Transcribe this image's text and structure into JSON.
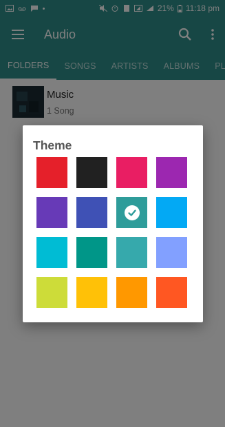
{
  "status": {
    "battery": "21%",
    "time": "11:18 pm"
  },
  "app_bar": {
    "title": "Audio"
  },
  "tabs": [
    {
      "label": "FOLDERS",
      "active": true
    },
    {
      "label": "SONGS"
    },
    {
      "label": "ARTISTS"
    },
    {
      "label": "ALBUMS"
    },
    {
      "label": "PLAYLISTS"
    }
  ],
  "list": [
    {
      "title": "Music",
      "subtitle": "1 Song"
    }
  ],
  "dialog": {
    "title": "Theme",
    "selected_index": 6,
    "swatches": [
      {
        "name": "red",
        "color": "#e5202a"
      },
      {
        "name": "black",
        "color": "#212121"
      },
      {
        "name": "pink",
        "color": "#e91e63"
      },
      {
        "name": "purple",
        "color": "#9c27b0"
      },
      {
        "name": "deep-purple",
        "color": "#673ab7"
      },
      {
        "name": "indigo",
        "color": "#3f51b5"
      },
      {
        "name": "teal-selected",
        "color": "#2e9c9a"
      },
      {
        "name": "light-blue",
        "color": "#03a9f4"
      },
      {
        "name": "cyan",
        "color": "#00bcd4"
      },
      {
        "name": "teal",
        "color": "#009688"
      },
      {
        "name": "light-teal",
        "color": "#36a9ac"
      },
      {
        "name": "periwinkle",
        "color": "#82a0ff"
      },
      {
        "name": "lime",
        "color": "#cddc39"
      },
      {
        "name": "amber",
        "color": "#ffc107"
      },
      {
        "name": "orange",
        "color": "#ff9800"
      },
      {
        "name": "deep-orange",
        "color": "#ff5722"
      }
    ]
  }
}
